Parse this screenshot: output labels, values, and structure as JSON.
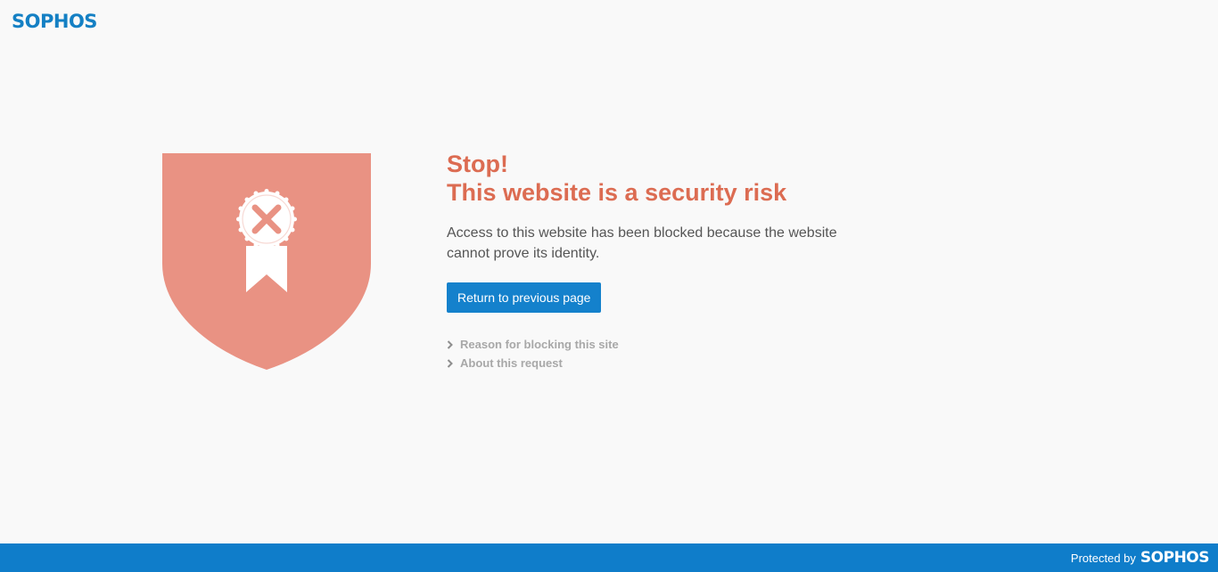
{
  "brand": {
    "logo_text": "SOPHOS",
    "color": "#1480c4"
  },
  "warning": {
    "title_line1": "Stop!",
    "title_line2": "This website is a security risk",
    "message": "Access to this website has been blocked because the website cannot prove its identity.",
    "title_color": "#dc6c52",
    "shield_color": "#e99283"
  },
  "actions": {
    "return_button_label": "Return to previous page",
    "button_color": "#1481cc"
  },
  "details": {
    "items": [
      {
        "label": "Reason for blocking this site"
      },
      {
        "label": "About this request"
      }
    ]
  },
  "footer": {
    "protected_text": "Protected by",
    "logo_text": "SOPHOS",
    "background_color": "#0f7dca"
  },
  "icons": {
    "shield": "shield-icon",
    "certificate": "certificate-badge-icon",
    "error": "x-icon",
    "chevron": "chevron-right-icon"
  }
}
